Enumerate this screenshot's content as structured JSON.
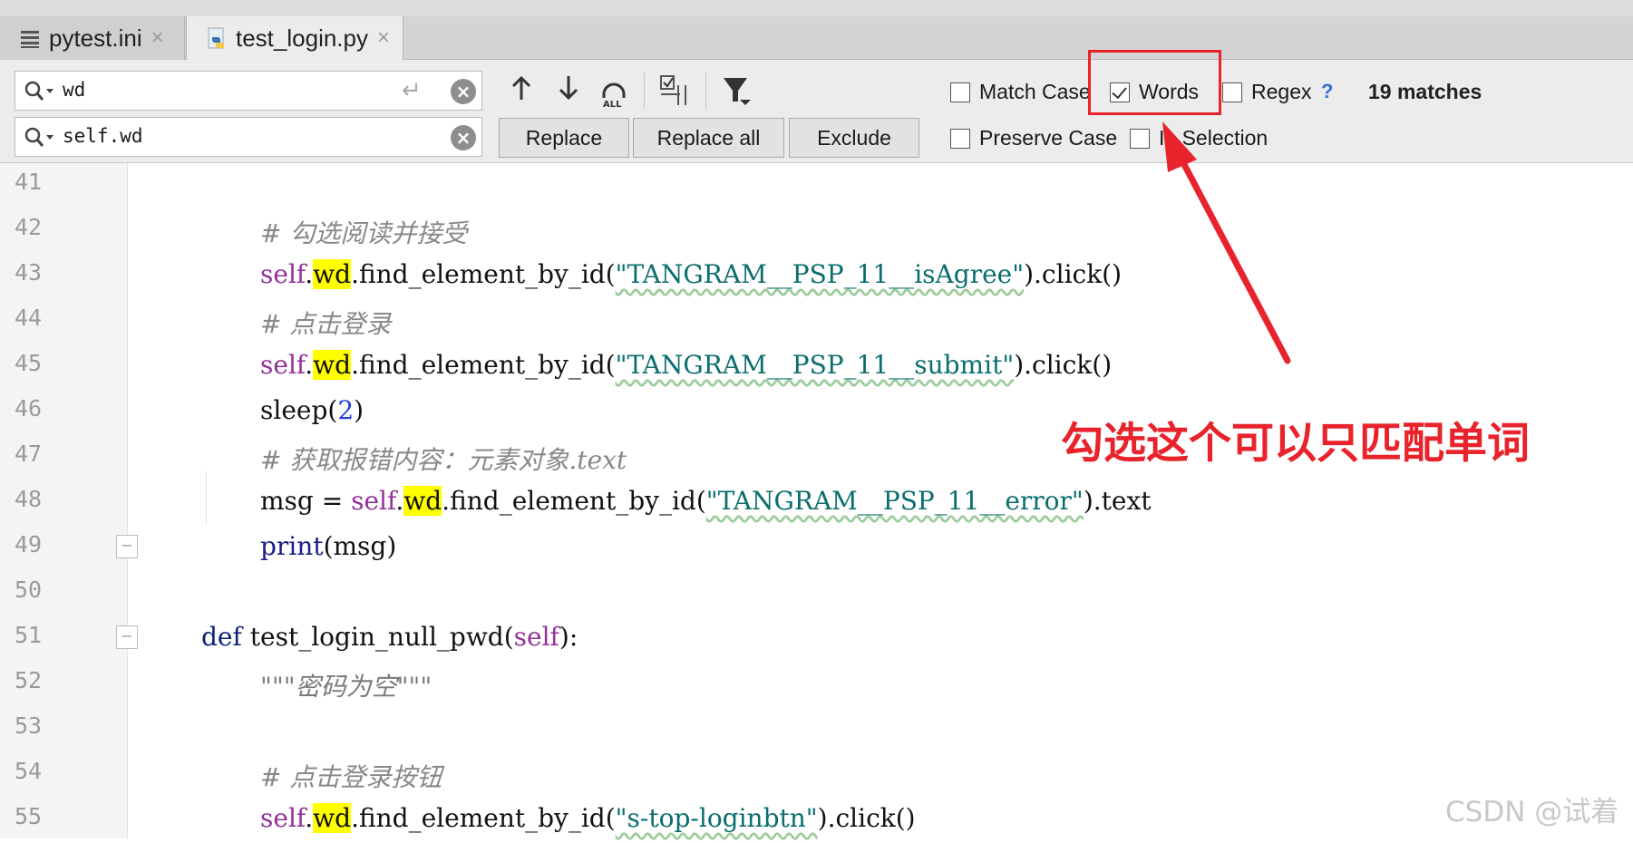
{
  "tabs": [
    {
      "label": "pytest.ini",
      "close": "×",
      "icon": "ini-file-icon"
    },
    {
      "label": "test_login.py",
      "close": "×",
      "icon": "python-file-icon"
    }
  ],
  "find": {
    "search_value": "wd",
    "replace_value": "self.wd",
    "enter_glyph": "↵",
    "clear_glyph": "×"
  },
  "buttons": {
    "replace": "Replace",
    "replace_all": "Replace all",
    "exclude": "Exclude"
  },
  "options": {
    "match_case": "Match Case",
    "words": "Words",
    "regex": "Regex",
    "help": "?",
    "preserve_case": "Preserve Case",
    "in_selection": "In Selection",
    "matches": "19 matches"
  },
  "code_lines": [
    {
      "n": "41"
    },
    {
      "n": "42",
      "comment": "# 勾选阅读并接受"
    },
    {
      "n": "43",
      "self": "self",
      "dot": ".",
      "match": "wd",
      "call": ".find_element_by_id(",
      "str": "\"TANGRAM__PSP_11__isAgree\"",
      "tail": ").click()"
    },
    {
      "n": "44",
      "comment": "# 点击登录"
    },
    {
      "n": "45",
      "self": "self",
      "dot": ".",
      "match": "wd",
      "call": ".find_element_by_id(",
      "str": "\"TANGRAM__PSP_11__submit\"",
      "tail": ").click()"
    },
    {
      "n": "46",
      "fn": "sleep(",
      "num": "2",
      "tail": ")"
    },
    {
      "n": "47",
      "comment": "# 获取报错内容：元素对象.text"
    },
    {
      "n": "48",
      "prefix": "msg = ",
      "self": "self",
      "dot": ".",
      "match": "wd",
      "call": ".find_element_by_id(",
      "str": "\"TANGRAM__PSP_11__error\"",
      "tail": ").text"
    },
    {
      "n": "49",
      "builtin": "print",
      "tail": "(msg)"
    },
    {
      "n": "50"
    },
    {
      "n": "51",
      "kw": "def",
      "fname": " test_login_null_pwd(",
      "self": "self",
      "tail": "):"
    },
    {
      "n": "52",
      "doc": "\"\"\"密码为空\"\"\""
    },
    {
      "n": "53"
    },
    {
      "n": "54",
      "comment": "# 点击登录按钮"
    },
    {
      "n": "55",
      "self": "self",
      "dot": ".",
      "match": "wd",
      "call": ".find_element_by_id(",
      "str": "\"s-top-loginbtn\"",
      "tail": ").click()"
    }
  ],
  "annotation": {
    "text": "勾选这个可以只匹配单词",
    "color": "#e8232c"
  },
  "watermark": "CSDN @试着"
}
